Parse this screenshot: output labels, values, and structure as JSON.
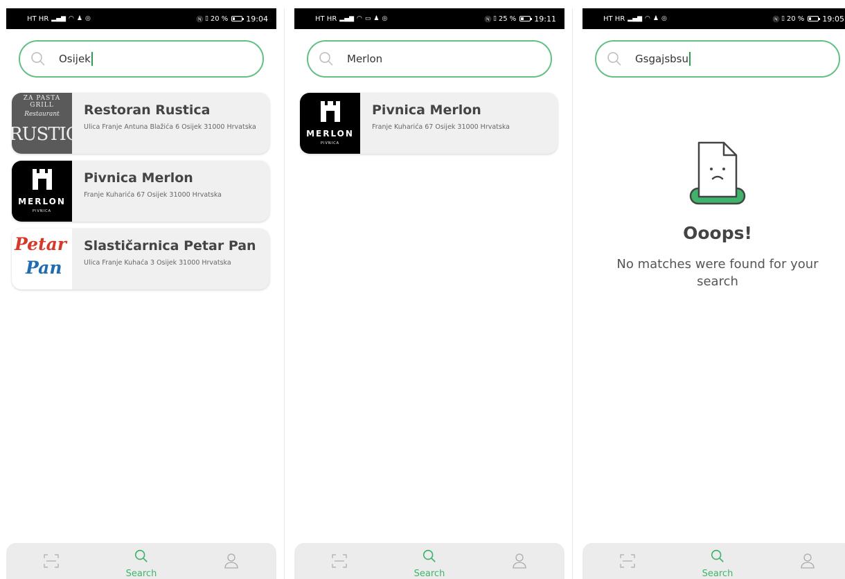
{
  "screens": [
    {
      "status": {
        "left": "HT HR",
        "battery_pct": "20 %",
        "battery_level": 0.2,
        "time": "19:04"
      },
      "search": {
        "query": "Osijek"
      },
      "results": [
        {
          "name": "Restoran Rustica",
          "address": "Ulica Franje Antuna Blažića 6 Osijek 31000 Hrvatska",
          "logo": "rustica-logo"
        },
        {
          "name": "Pivnica Merlon",
          "address": "Franje Kuharića 67 Osijek 31000 Hrvatska",
          "logo": "merlon-logo"
        },
        {
          "name": "Slastičarnica Petar Pan",
          "address": "Ulica Franje Kuhaća 3 Osijek 31000 Hrvatska",
          "logo": "petar-pan-logo"
        }
      ]
    },
    {
      "status": {
        "left": "HT HR",
        "battery_pct": "25 %",
        "battery_level": 0.25,
        "time": "19:11"
      },
      "search": {
        "query": "Merlon"
      },
      "results": [
        {
          "name": "Pivnica Merlon",
          "address": "Franje Kuharića 67 Osijek 31000 Hrvatska",
          "logo": "merlon-logo"
        }
      ]
    },
    {
      "status": {
        "left": "HT HR",
        "battery_pct": "20 %",
        "battery_level": 0.2,
        "time": "19:05"
      },
      "search": {
        "query": "Gsgajsbsu"
      },
      "empty": {
        "title": "Ooops!",
        "message": "No matches were found for your search",
        "icon": "sad-document-icon"
      }
    }
  ],
  "logos": {
    "rustica": {
      "line1": "ZA PASTA GRILL",
      "line2": "Restaurant",
      "line3": "RUSTICA"
    },
    "merlon": {
      "word": "MERLON",
      "sub": "PIVNICA"
    },
    "petar_pan": {
      "line1": "Petar",
      "line2": "Pan"
    }
  },
  "nav": {
    "items": [
      {
        "id": "scan",
        "icon": "scan-icon",
        "label": ""
      },
      {
        "id": "search",
        "icon": "search-icon",
        "label": "Search",
        "active": true
      },
      {
        "id": "profile",
        "icon": "user-icon",
        "label": ""
      }
    ]
  },
  "colors": {
    "accent": "#3fb36b",
    "search_border": "#62c084",
    "card_bg": "#f0f0f0",
    "nav_bg": "#ececec"
  }
}
